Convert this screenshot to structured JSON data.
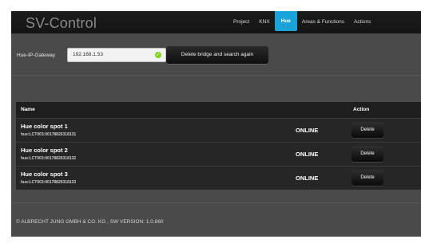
{
  "app": {
    "logo": "SV-Control"
  },
  "nav": {
    "items": [
      {
        "label": "Project"
      },
      {
        "label": "KNX"
      },
      {
        "label": "Hue"
      },
      {
        "label": "Areas & Functions"
      },
      {
        "label": "Actions"
      }
    ],
    "active": "Hue"
  },
  "gateway": {
    "label": "Hue-IP-Gateway",
    "ip_value": "192.168.1.53",
    "status_icon": "check-circle-icon",
    "status_color": "#7ed321",
    "button_label": "Delete bridge and search again"
  },
  "table": {
    "headers": {
      "name": "Name",
      "action": "Action"
    },
    "rows": [
      {
        "name": "Hue color spot 1",
        "id": "hue:LCT003:00178826318131",
        "status": "ONLINE",
        "action": "Delete"
      },
      {
        "name": "Hue color spot 2",
        "id": "hue:LCT003:00178826318132",
        "status": "ONLINE",
        "action": "Delete"
      },
      {
        "name": "Hue color spot 3",
        "id": "hue:LCT003:00178826318133",
        "status": "ONLINE",
        "action": "Delete"
      }
    ]
  },
  "footer": {
    "text": "© ALBRECHT JUNG GMBH & CO. KG , SW VERSION: 1.0.860"
  },
  "colors": {
    "accent": "#1aa3d9",
    "background": "#4a4a4a",
    "topbar": "#141414"
  }
}
